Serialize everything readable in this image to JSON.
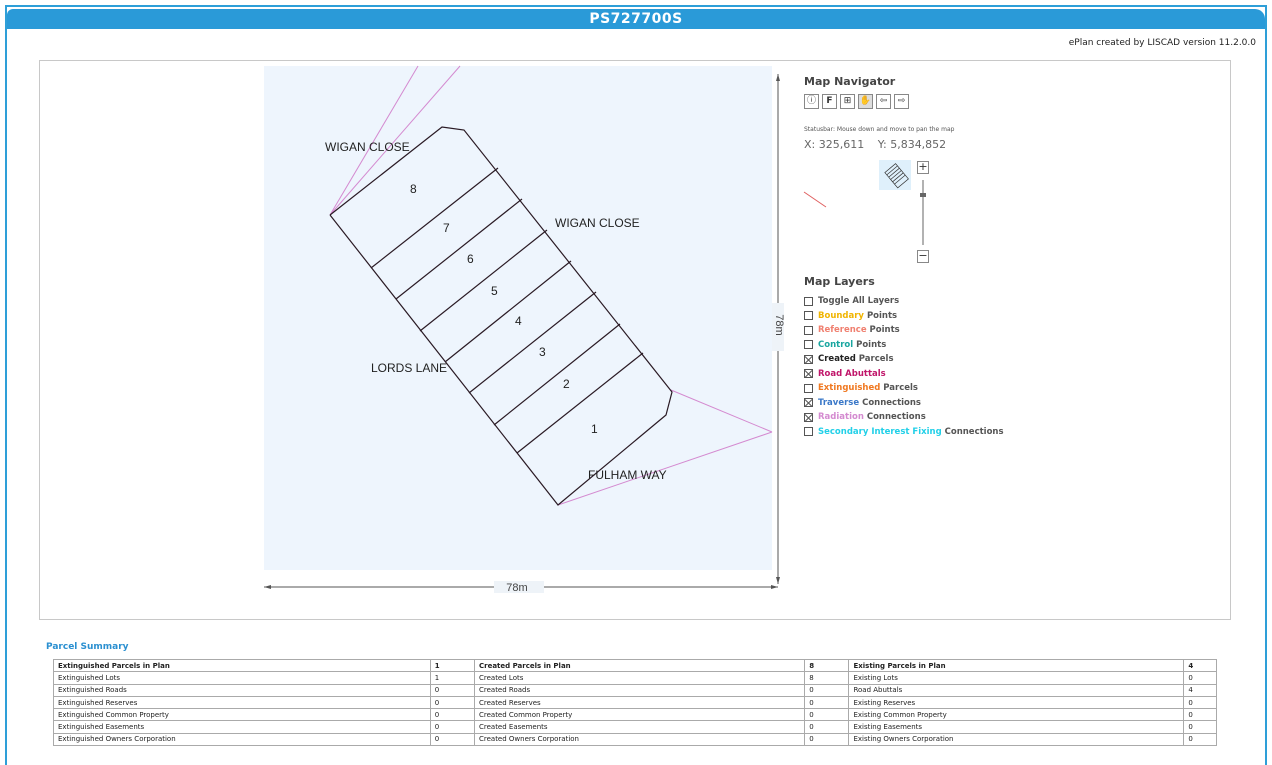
{
  "title": "PS727700S",
  "version_text": "ePlan created by LISCAD version 11.2.0.0",
  "map": {
    "labels": {
      "wigan_close_1": "WIGAN CLOSE",
      "wigan_close_2": "WIGAN CLOSE",
      "lords_lane": "LORDS LANE",
      "fulham_way": "FULHAM WAY"
    },
    "lots": [
      "8",
      "7",
      "6",
      "5",
      "4",
      "3",
      "2",
      "1"
    ],
    "scale_x": "78m",
    "scale_y": "78m"
  },
  "navigator": {
    "title": "Map Navigator",
    "tools": [
      {
        "name": "info-tool-icon",
        "glyph": "ⓘ"
      },
      {
        "name": "full-extent-tool-icon",
        "glyph": "F"
      },
      {
        "name": "zoom-box-tool-icon",
        "glyph": "⊞"
      },
      {
        "name": "pan-hand-tool-icon",
        "glyph": "✋"
      },
      {
        "name": "previous-extent-tool-icon",
        "glyph": "⇦"
      },
      {
        "name": "next-extent-tool-icon",
        "glyph": "⇨"
      }
    ],
    "statusbar": "Statusbar: Mouse down and move to pan the map",
    "x_coord": "X: 325,611",
    "y_coord": "Y: 5,834,852",
    "zoom_in": "+",
    "zoom_out": "−"
  },
  "layers": {
    "title": "Map Layers",
    "items": [
      {
        "prefix": "Toggle All Layers",
        "suffix": "",
        "color": "#555555",
        "checked": false
      },
      {
        "prefix": "Boundary",
        "suffix": " Points",
        "color": "#f0b400",
        "checked": false
      },
      {
        "prefix": "Reference",
        "suffix": " Points",
        "color": "#f08070",
        "checked": false
      },
      {
        "prefix": "Control",
        "suffix": " Points",
        "color": "#1aa6a0",
        "checked": false
      },
      {
        "prefix": "Created",
        "suffix": " Parcels",
        "color": "#222222",
        "checked": true
      },
      {
        "prefix": "Road Abuttals",
        "suffix": "",
        "color": "#c0166a",
        "checked": true
      },
      {
        "prefix": "Extinguished",
        "suffix": " Parcels",
        "color": "#f07820",
        "checked": false
      },
      {
        "prefix": "Traverse",
        "suffix": " Connections",
        "color": "#3a78c8",
        "checked": true
      },
      {
        "prefix": "Radiation",
        "suffix": " Connections",
        "color": "#d48ad0",
        "checked": true
      },
      {
        "prefix": "Secondary Interest Fixing",
        "suffix": " Connections",
        "color": "#22d0e8",
        "checked": false
      }
    ]
  },
  "summary": {
    "title": "Parcel Summary",
    "rows": [
      [
        "Extinguished Parcels in Plan",
        "1",
        "Created Parcels in Plan",
        "8",
        "Existing Parcels in Plan",
        "4"
      ],
      [
        "Extinguished Lots",
        "1",
        "Created Lots",
        "8",
        "Existing Lots",
        "0"
      ],
      [
        "Extinguished Roads",
        "0",
        "Created Roads",
        "0",
        "Road Abuttals",
        "4"
      ],
      [
        "Extinguished Reserves",
        "0",
        "Created Reserves",
        "0",
        "Existing Reserves",
        "0"
      ],
      [
        "Extinguished Common Property",
        "0",
        "Created Common Property",
        "0",
        "Existing Common Property",
        "0"
      ],
      [
        "Extinguished Easements",
        "0",
        "Created Easements",
        "0",
        "Existing Easements",
        "0"
      ],
      [
        "Extinguished Owners Corporation",
        "0",
        "Created Owners Corporation",
        "0",
        "Existing Owners Corporation",
        "0"
      ]
    ]
  }
}
